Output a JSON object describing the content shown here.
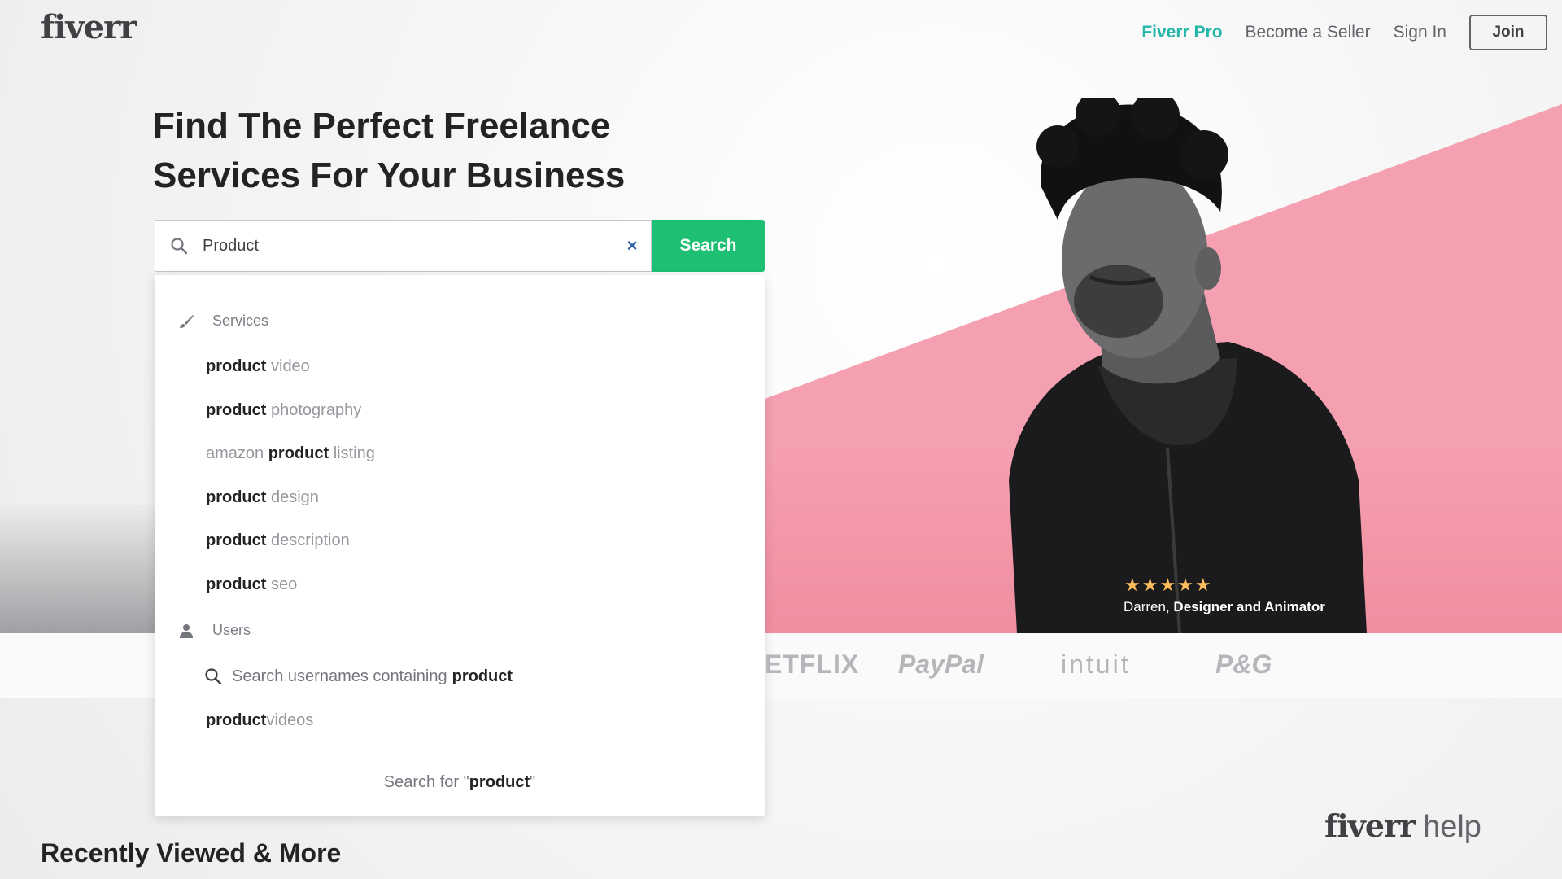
{
  "header": {
    "logo": "fiverr",
    "nav": {
      "fiverr_pro": "Fiverr Pro",
      "become_seller": "Become a Seller",
      "sign_in": "Sign In",
      "join": "Join"
    }
  },
  "hero": {
    "title_line1": "Find The Perfect Freelance",
    "title_line2": "Services For Your Business",
    "search": {
      "value": "Product",
      "button_label": "Search",
      "clear_label": "×"
    },
    "person_rating_stars": 5,
    "person_caption_name": "Darren,",
    "person_caption_role": "Designer and Animator"
  },
  "dropdown": {
    "services_heading": "Services",
    "suggestions": [
      {
        "before": "",
        "bold": "product",
        "after": " video"
      },
      {
        "before": "",
        "bold": "product",
        "after": " photography"
      },
      {
        "before": "amazon ",
        "bold": "product",
        "after": " listing"
      },
      {
        "before": "",
        "bold": "product",
        "after": " design"
      },
      {
        "before": "",
        "bold": "product",
        "after": " description"
      },
      {
        "before": "",
        "bold": "product",
        "after": " seo"
      }
    ],
    "users_heading": "Users",
    "user_search_text": "Search usernames containing",
    "user_search_bold": "product",
    "user_result_bold": "product",
    "user_result_rest": "videos",
    "footer_text": "Search for \"",
    "footer_bold": "product",
    "footer_end": "\""
  },
  "trusted_by": [
    "ETFLIX",
    "PayPal",
    "intuit",
    "P&G"
  ],
  "sections": {
    "recent_title": "Recently Viewed & More"
  },
  "help_widget": {
    "brand": "fiverr",
    "label": "help"
  },
  "colors": {
    "accent_green": "#1dbf73",
    "pro_teal": "#21b6a8",
    "hero_pink": "#f5a0b0",
    "star_yellow": "#ffbe5b"
  }
}
